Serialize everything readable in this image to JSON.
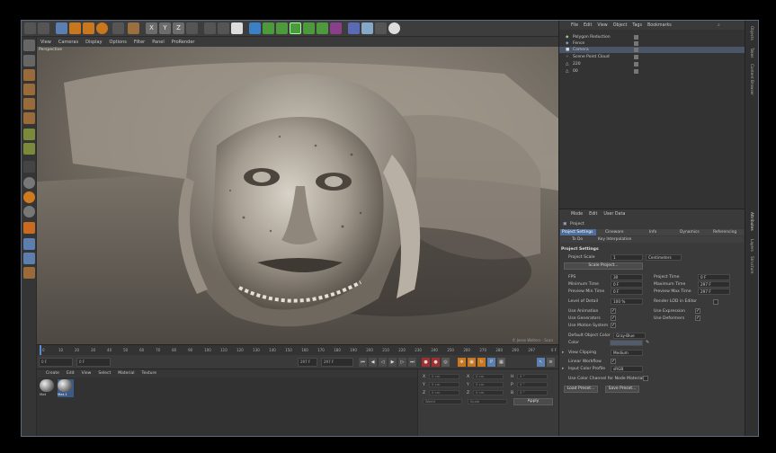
{
  "viewport": {
    "menu": [
      "View",
      "Cameras",
      "Display",
      "Options",
      "Filter",
      "Panel",
      "ProRender"
    ],
    "label": "Perspective",
    "watermark": "© Jesse Walters - Scan",
    "ruler": [
      "0",
      "10",
      "20",
      "30",
      "40",
      "50",
      "60",
      "70",
      "80",
      "90",
      "100",
      "110",
      "120",
      "130",
      "140",
      "150",
      "160",
      "170",
      "180",
      "190",
      "200",
      "210",
      "220",
      "230",
      "240",
      "250",
      "260",
      "270",
      "280",
      "290",
      "297"
    ],
    "frame_end": "0 F"
  },
  "playback": {
    "start": "0 F",
    "current": "0 F",
    "end": "297 F",
    "end2": "297 F"
  },
  "materials": {
    "menu": [
      "Create",
      "Edit",
      "View",
      "Select",
      "Material",
      "Texture"
    ],
    "items": [
      {
        "name": "Mat"
      },
      {
        "name": "Mat.1"
      }
    ]
  },
  "coords": {
    "rows": [
      {
        "a": "X",
        "av": "0 cm",
        "b": "X",
        "bv": "0 cm",
        "c": "H",
        "cv": "0 °"
      },
      {
        "a": "Y",
        "av": "0 cm",
        "b": "Y",
        "bv": "0 cm",
        "c": "P",
        "cv": "0 °"
      },
      {
        "a": "Z",
        "av": "0 cm",
        "b": "Z",
        "bv": "0 cm",
        "c": "B",
        "cv": "0 °"
      }
    ],
    "world": "World",
    "scale": "Scale",
    "apply": "Apply"
  },
  "objects": {
    "menu": [
      "File",
      "Edit",
      "View",
      "Object",
      "Tags",
      "Bookmarks"
    ],
    "rows": [
      {
        "name": "Polygon Reduction"
      },
      {
        "name": "Fence"
      },
      {
        "name": "Camera"
      },
      {
        "name": "Scene Point Cloud"
      },
      {
        "name": "220"
      },
      {
        "name": "00"
      }
    ]
  },
  "attributes": {
    "menu": [
      "Mode",
      "Edit",
      "User Data"
    ],
    "object": "Project",
    "tabs": [
      "Project Settings",
      "Cineware",
      "Info",
      "Dynamics",
      "Referencing"
    ],
    "subtabs": [
      "To Do",
      "Key Interpolation"
    ],
    "section": "Project Settings",
    "project_scale_label": "Project Scale",
    "project_scale_value": "1",
    "project_scale_unit": "Centimeters",
    "scale_project_btn": "Scale Project...",
    "fps_label": "FPS",
    "fps_value": "30",
    "project_time_label": "Project Time",
    "project_time_value": "0 F",
    "min_time_label": "Minimum Time",
    "min_time_value": "0 F",
    "max_time_label": "Maximum Time",
    "max_time_value": "297 F",
    "prev_min_label": "Preview Min Time",
    "prev_min_value": "0 F",
    "prev_max_label": "Preview Max Time",
    "prev_max_value": "297 F",
    "lod_label": "Level of Detail",
    "lod_value": "100 %",
    "render_lod_label": "Render LOD in Editor",
    "use_animation": "Use Animation",
    "use_expression": "Use Expression",
    "use_generators": "Use Generators",
    "use_deformers": "Use Deformers",
    "use_motion": "Use Motion System",
    "default_color_label": "Default Object Color",
    "default_color_value": "Gray-Blue",
    "color_label": "Color",
    "view_clipping_label": "View Clipping",
    "view_clipping_value": "Medium",
    "linear_workflow": "Linear Workflow",
    "input_color_label": "Input Color Profile",
    "input_color_value": "sRGB",
    "use_color_channel": "Use Color Channel for Node Material",
    "load_preset": "Load Preset...",
    "save_preset": "Save Preset..."
  },
  "side_tabs": [
    "Objects",
    "Takes",
    "Content Browser",
    "Attributes",
    "Layers",
    "Structure"
  ]
}
